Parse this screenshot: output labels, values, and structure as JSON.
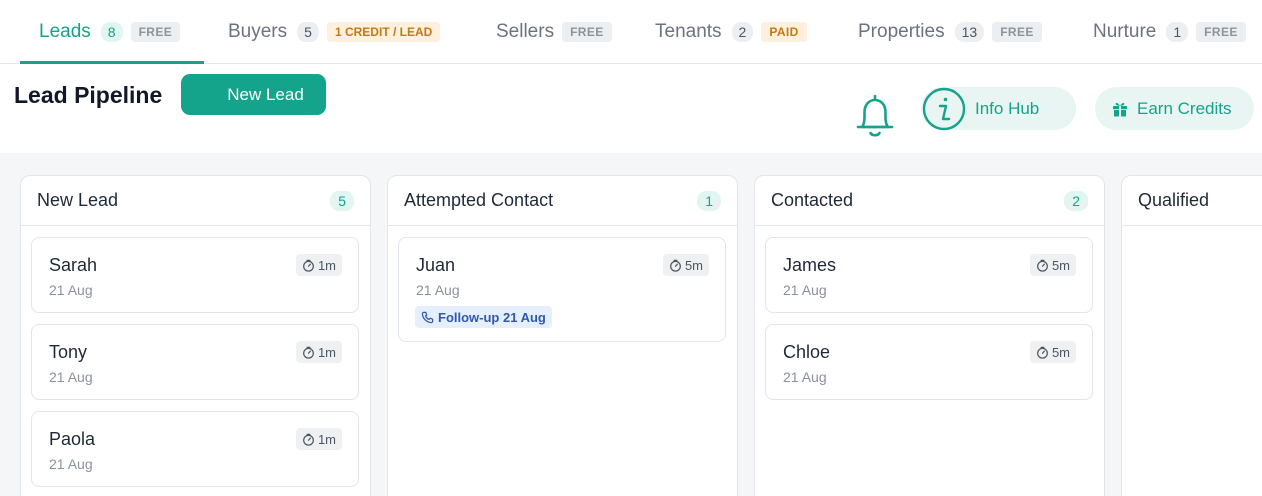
{
  "tabs": [
    {
      "label": "Leads",
      "count": "8",
      "badge": "FREE",
      "badge_type": "free",
      "active": true
    },
    {
      "label": "Buyers",
      "count": "5",
      "badge": "1 CREDIT / LEAD",
      "badge_type": "credit",
      "active": false
    },
    {
      "label": "Sellers",
      "count": "",
      "badge": "FREE",
      "badge_type": "free",
      "active": false
    },
    {
      "label": "Tenants",
      "count": "2",
      "badge": "PAID",
      "badge_type": "paid",
      "active": false
    },
    {
      "label": "Properties",
      "count": "13",
      "badge": "FREE",
      "badge_type": "free",
      "active": false
    },
    {
      "label": "Nurture",
      "count": "1",
      "badge": "FREE",
      "badge_type": "free",
      "active": false
    }
  ],
  "header": {
    "title": "Lead Pipeline",
    "new_lead_label": "New Lead",
    "bell_icon": "bell-icon",
    "info_hub_label": "Info Hub",
    "earn_credits_label": "Earn Credits"
  },
  "colors": {
    "accent": "#14a38b",
    "accent_light": "#e1f5f1",
    "credit_badge": "#c27a13",
    "followup_tag": "#2f5aa8"
  },
  "columns": [
    {
      "title": "New Lead",
      "count": "5",
      "cards": [
        {
          "name": "Sarah",
          "date": "21 Aug",
          "time": "1m"
        },
        {
          "name": "Tony",
          "date": "21 Aug",
          "time": "1m"
        },
        {
          "name": "Paola",
          "date": "21 Aug",
          "time": "1m"
        }
      ]
    },
    {
      "title": "Attempted Contact",
      "count": "1",
      "cards": [
        {
          "name": "Juan",
          "date": "21 Aug",
          "time": "5m",
          "tag": "Follow-up 21 Aug"
        }
      ]
    },
    {
      "title": "Contacted",
      "count": "2",
      "cards": [
        {
          "name": "James",
          "date": "21 Aug",
          "time": "5m"
        },
        {
          "name": "Chloe",
          "date": "21 Aug",
          "time": "5m"
        }
      ]
    },
    {
      "title": "Qualified",
      "count": "",
      "cards": []
    }
  ]
}
